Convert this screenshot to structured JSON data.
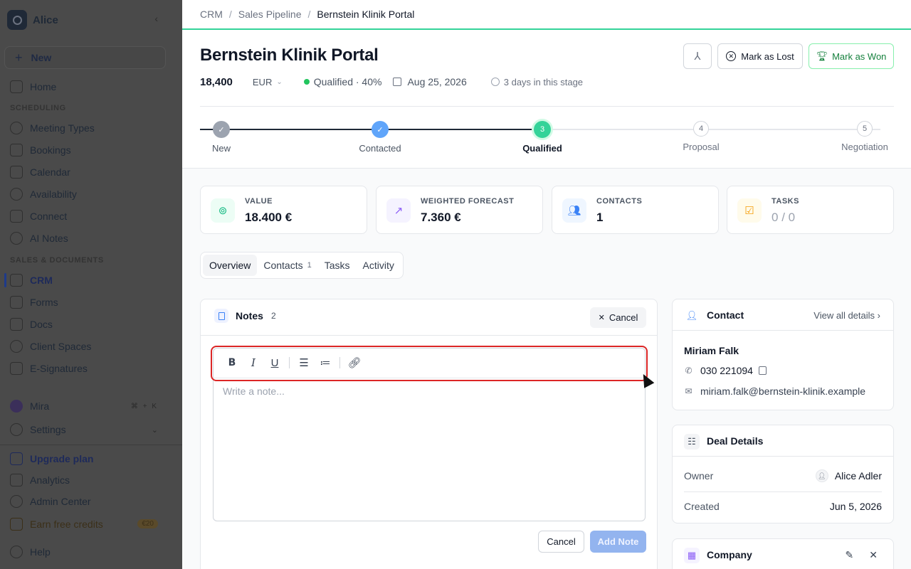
{
  "sidebar": {
    "org_name": "Alice",
    "new_label": "New",
    "items_top": [
      {
        "label": "Home"
      }
    ],
    "section_scheduling": "SCHEDULING",
    "scheduling": [
      {
        "label": "Meeting Types"
      },
      {
        "label": "Bookings"
      },
      {
        "label": "Calendar"
      },
      {
        "label": "Availability"
      },
      {
        "label": "Connect"
      },
      {
        "label": "AI Notes"
      }
    ],
    "section_sales": "SALES & DOCUMENTS",
    "sales": [
      {
        "label": "CRM"
      },
      {
        "label": "Forms"
      },
      {
        "label": "Docs"
      },
      {
        "label": "Client Spaces"
      },
      {
        "label": "E-Signatures"
      }
    ],
    "mira": "Mira",
    "mira_kbd": "⌘ + K",
    "settings": "Settings",
    "upgrade": "Upgrade plan",
    "analytics": "Analytics",
    "admin": "Admin Center",
    "earn": "Earn free credits",
    "earn_badge": "€20",
    "help": "Help"
  },
  "breadcrumb": {
    "root": "CRM",
    "parent": "Sales Pipeline",
    "current": "Bernstein Klinik Portal"
  },
  "deal": {
    "title": "Bernstein Klinik Portal",
    "amount": "18,400",
    "currency": "EUR",
    "stage": "Qualified · 40%",
    "close_date": "Aug 25, 2026",
    "days_in_stage": "3 days in this stage"
  },
  "actions": {
    "mark_lost": "Mark as Lost",
    "mark_won": "Mark as Won"
  },
  "stages": [
    {
      "num": "✓",
      "label": "New"
    },
    {
      "num": "✓",
      "label": "Contacted"
    },
    {
      "num": "3",
      "label": "Qualified"
    },
    {
      "num": "4",
      "label": "Proposal"
    },
    {
      "num": "5",
      "label": "Negotiation"
    }
  ],
  "stats": [
    {
      "label": "VALUE",
      "value": "18.400 €"
    },
    {
      "label": "WEIGHTED FORECAST",
      "value": "7.360 €"
    },
    {
      "label": "CONTACTS",
      "value": "1"
    },
    {
      "label": "TASKS",
      "value_done": "0",
      "value_sep": "/",
      "value_total": "0"
    }
  ],
  "tabs": [
    {
      "label": "Overview"
    },
    {
      "label": "Contacts",
      "count": "1"
    },
    {
      "label": "Tasks"
    },
    {
      "label": "Activity"
    }
  ],
  "notes": {
    "title": "Notes",
    "count": "2",
    "cancel_label": "Cancel",
    "placeholder": "Write a note...",
    "footer_cancel": "Cancel",
    "add_note": "Add Note"
  },
  "contact": {
    "title": "Contact",
    "view_all": "View all details",
    "name": "Miriam Falk",
    "phone": "030 221094",
    "email": "miriam.falk@bernstein-klinik.example"
  },
  "deal_details": {
    "title": "Deal Details",
    "owner_label": "Owner",
    "owner_value": "Alice Adler",
    "created_label": "Created",
    "created_value": "Jun 5, 2026"
  },
  "company": {
    "title": "Company"
  },
  "colors": {
    "accent_green": "#34d399",
    "highlight_red": "#dc2626",
    "add_note_btn": "#93b4ef"
  }
}
